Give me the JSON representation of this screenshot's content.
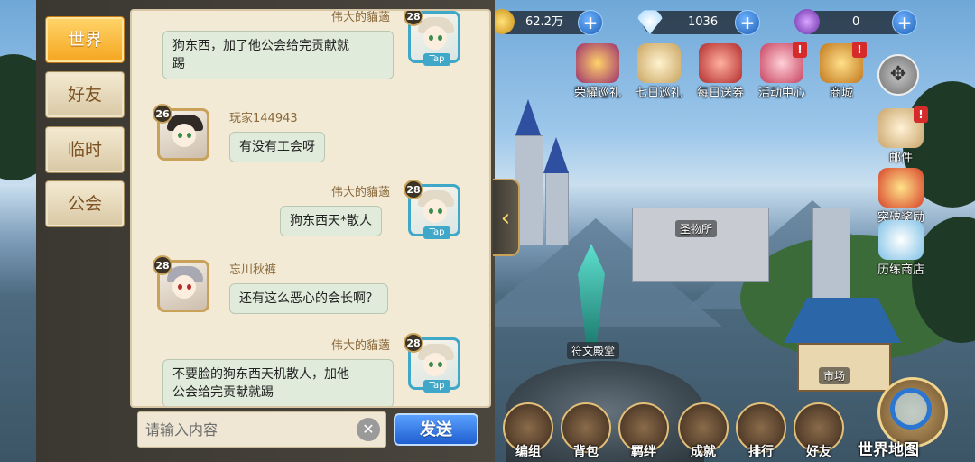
{
  "resources": {
    "gold": "62.2万",
    "diamond": "1036",
    "potion": "0"
  },
  "top_menu": [
    {
      "label": "荣耀巡礼",
      "badge": ""
    },
    {
      "label": "七日巡礼",
      "badge": ""
    },
    {
      "label": "每日送券",
      "badge": ""
    },
    {
      "label": "活动中心",
      "badge": "!"
    },
    {
      "label": "商城",
      "badge": "!"
    }
  ],
  "side_menu": [
    {
      "label": "邮件",
      "badge": "!"
    },
    {
      "label": "突破奖励",
      "badge": ""
    },
    {
      "label": "历练商店",
      "badge": ""
    }
  ],
  "map_labels": {
    "sanctuary": "圣物所",
    "rune_hall": "符文殿堂",
    "market": "市场"
  },
  "bottom_nav": [
    "编组",
    "背包",
    "羁绊",
    "成就",
    "排行",
    "好友"
  ],
  "world_map_label": "世界地图",
  "chat": {
    "tabs": [
      "世界",
      "好友",
      "临时",
      "公会"
    ],
    "active_tab": "世界",
    "messages": [
      {
        "sender": "伟大的貓藡",
        "level": "28",
        "mine": true,
        "tap": "Tap",
        "lines": [
          "狗东西，加了他公会给完贡献就",
          "踢"
        ]
      },
      {
        "sender": "玩家144943",
        "level": "26",
        "mine": false,
        "lines": [
          "有没有工会呀"
        ]
      },
      {
        "sender": "伟大的貓藡",
        "level": "28",
        "mine": true,
        "tap": "Tap",
        "lines": [
          "狗东西天*散人"
        ]
      },
      {
        "sender": "忘川秋裤",
        "level": "28",
        "mine": false,
        "lines": [
          "还有这么恶心的会长啊？"
        ]
      },
      {
        "sender": "伟大的貓藡",
        "level": "28",
        "mine": true,
        "tap": "Tap",
        "lines": [
          "不要脸的狗东西天机散人，加他",
          "公会给完贡献就踢"
        ]
      }
    ],
    "input_placeholder": "请输入内容",
    "send_label": "发送"
  }
}
